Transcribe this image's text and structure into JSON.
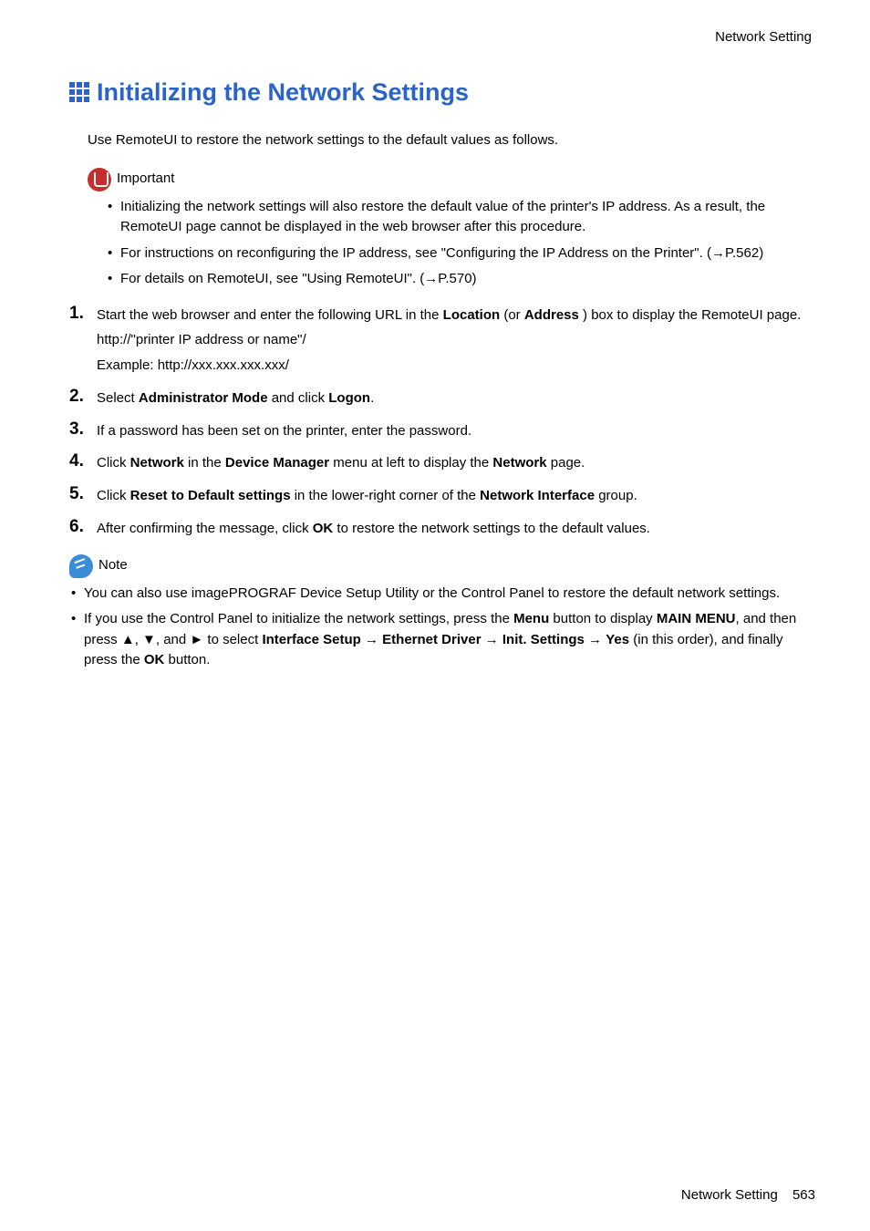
{
  "header": {
    "section": "Network Setting"
  },
  "title": "Initializing the Network Settings",
  "intro": "Use RemoteUI to restore the network settings to the default values as follows.",
  "important": {
    "label": "Important",
    "items": [
      "Initializing the network settings will also restore the default value of the printer's IP address. As a result, the RemoteUI page cannot be displayed in the web browser after this procedure.",
      "For instructions on reconfiguring the IP address, see \"Configuring the IP Address on the Printer\". (→P.562)",
      "For details on RemoteUI, see \"Using RemoteUI\". (→P.570)"
    ]
  },
  "steps": [
    {
      "num": "1.",
      "pre": "Start the web browser and enter the following URL in the ",
      "b1": "Location",
      "mid": " (or ",
      "b2": "Address",
      "post": " ) box to display the RemoteUI page.",
      "line2": "http://\"printer IP address or name\"/",
      "line3": "Example: http://xxx.xxx.xxx.xxx/"
    },
    {
      "num": "2.",
      "pre": "Select ",
      "b1": "Administrator Mode",
      "mid": " and click ",
      "b2": "Logon",
      "post": "."
    },
    {
      "num": "3.",
      "pre": "If a password has been set on the printer, enter the password."
    },
    {
      "num": "4.",
      "pre": "Click ",
      "b1": "Network",
      "mid": " in the ",
      "b2": "Device Manager",
      "mid2": " menu at left to display the ",
      "b3": "Network",
      "post": " page."
    },
    {
      "num": "5.",
      "pre": "Click ",
      "b1": "Reset to Default settings",
      "mid": " in the lower-right corner of the ",
      "b2": "Network Interface",
      "post": " group."
    },
    {
      "num": "6.",
      "pre": "After confirming the message, click ",
      "b1": "OK",
      "post": " to restore the network settings to the default values."
    }
  ],
  "note": {
    "label": "Note",
    "item1": "You can also use imagePROGRAF Device Setup Utility or the Control Panel to restore the default network settings.",
    "item2": {
      "t1": "If you use the Control Panel to initialize the network settings, press the ",
      "b1": "Menu",
      "t2": " button to display ",
      "b2": "MAIN MENU",
      "t3": ", and then press ▲, ▼, and ► to select ",
      "b3": "Interface Setup",
      "t4": " → ",
      "b4": "Ethernet Driver",
      "t5": " → ",
      "b5": "Init. Settings",
      "t6": " → ",
      "b6": "Yes",
      "t7": " (in this order), and finally press the ",
      "b7": "OK",
      "t8": " button."
    }
  },
  "footer": {
    "section": "Network Setting",
    "page": "563"
  }
}
